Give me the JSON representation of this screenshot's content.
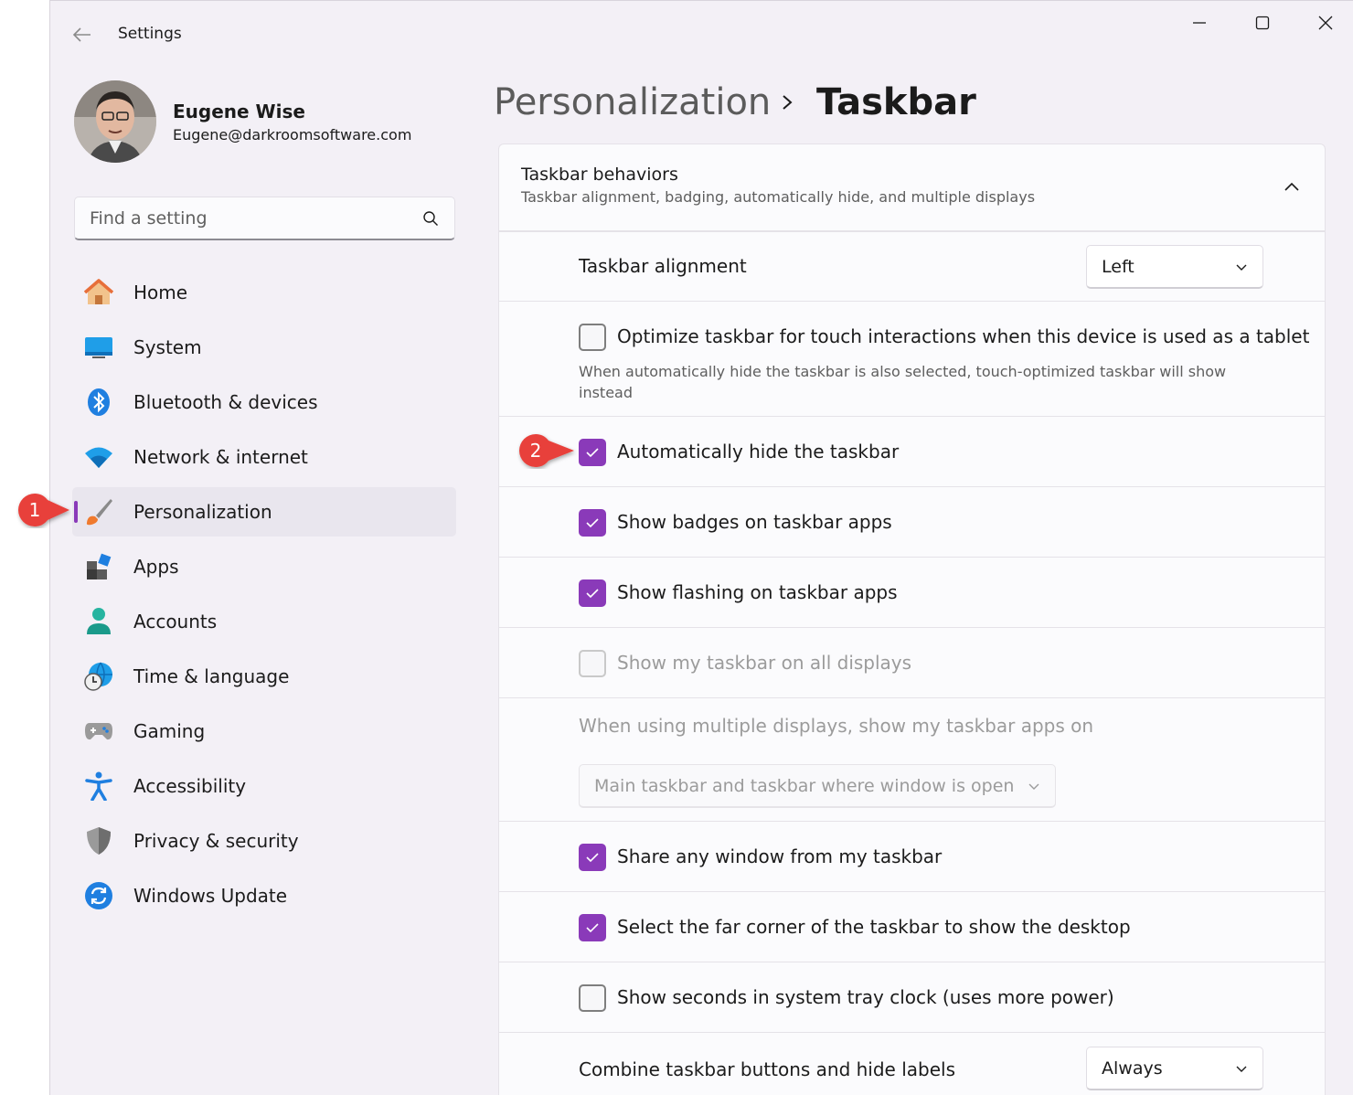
{
  "window": {
    "title": "Settings",
    "back_icon": "arrow-left-icon",
    "controls": [
      "minimize-icon",
      "maximize-icon",
      "close-icon"
    ]
  },
  "profile": {
    "name": "Eugene Wise",
    "email": "Eugene@darkroomsoftware.com"
  },
  "search": {
    "placeholder": "Find a setting",
    "icon": "search-icon"
  },
  "nav": {
    "items": [
      {
        "label": "Home",
        "icon": "home-icon"
      },
      {
        "label": "System",
        "icon": "system-icon"
      },
      {
        "label": "Bluetooth & devices",
        "icon": "bluetooth-icon"
      },
      {
        "label": "Network & internet",
        "icon": "wifi-icon"
      },
      {
        "label": "Personalization",
        "icon": "brush-icon",
        "selected": true
      },
      {
        "label": "Apps",
        "icon": "apps-icon"
      },
      {
        "label": "Accounts",
        "icon": "person-icon"
      },
      {
        "label": "Time & language",
        "icon": "globe-clock-icon"
      },
      {
        "label": "Gaming",
        "icon": "gamepad-icon"
      },
      {
        "label": "Accessibility",
        "icon": "accessibility-icon"
      },
      {
        "label": "Privacy & security",
        "icon": "shield-icon"
      },
      {
        "label": "Windows Update",
        "icon": "update-icon"
      }
    ]
  },
  "header": {
    "parent": "Personalization",
    "current": "Taskbar"
  },
  "section": {
    "title": "Taskbar behaviors",
    "subtitle": "Taskbar alignment, badging, automatically hide, and multiple displays",
    "alignment_label": "Taskbar alignment",
    "alignment_value": "Left",
    "touch_label": "Optimize taskbar for touch interactions when this device is used as a tablet",
    "touch_hint": "When automatically hide the taskbar is also selected, touch-optimized taskbar will show instead",
    "autohide_label": "Automatically hide the taskbar",
    "badges_label": "Show badges on taskbar apps",
    "flashing_label": "Show flashing on taskbar apps",
    "all_displays_label": "Show my taskbar on all displays",
    "multi_display_label": "When using multiple displays, show my taskbar apps on",
    "multi_display_value": "Main taskbar and taskbar where window is open",
    "share_label": "Share any window from my taskbar",
    "far_corner_label": "Select the far corner of the taskbar to show the desktop",
    "seconds_label": "Show seconds in system tray clock (uses more power)",
    "combine_label": "Combine taskbar buttons and hide labels",
    "combine_value": "Always"
  },
  "callouts": [
    "1",
    "2"
  ],
  "colors": {
    "accent": "#8a3ab9",
    "callout": "#e8403a",
    "window_bg": "#f3f0f6"
  }
}
